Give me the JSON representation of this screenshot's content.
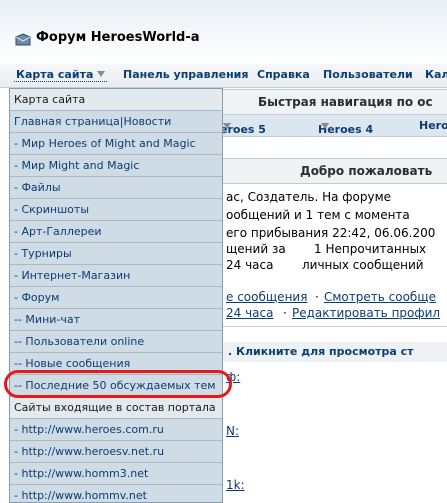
{
  "title": "Форум HeroesWorld-a",
  "navbar": [
    "Карта сайта",
    "Панель управления",
    "Справка",
    "Пользователи",
    "Кал"
  ],
  "quick_nav": "Быстрая навигация по ос",
  "heroes_tabs": [
    "eroes 5",
    "Heroes 4",
    "Hero"
  ],
  "welcome": "Добро пожаловать",
  "body_lines": [
    "ас, Создатель. На форуме",
    "ообщений и 1 тем с момента",
    "его прибывания 22:42, 06.06.200",
    "щений за",
    "1 Непрочитанных",
    "24 часа",
    "личных сообщений"
  ],
  "body_links": [
    "е сообщения",
    "Смотреть сообще",
    "24 часа",
    "Редактировать профил"
  ],
  "info_bar": ". Кликните для просмотра ст",
  "menu": {
    "sitemap_header": "Карта сайта",
    "sitemap_items": [
      "Главная страница|Новости",
      "- Мир Heroes of Might and Magic",
      "- Мир Might and Magic",
      "- Файлы",
      "- Скриншоты",
      "- Арт-Галлереи",
      "- Турниры",
      "- Интернет-Магазин",
      "- Форум",
      "-- Мини-чат",
      "-- Пользователи online",
      "-- Новые сообщения",
      "-- Последние 50 обсуждаемых тем"
    ],
    "portal_header": "Сайты входящие в состав портала",
    "portal_items": [
      "- http://www.heroes.com.ru",
      "- http://www.heroesv.net.ru",
      "- http://www.homm3.net",
      "- http://www.hommv.net"
    ]
  }
}
